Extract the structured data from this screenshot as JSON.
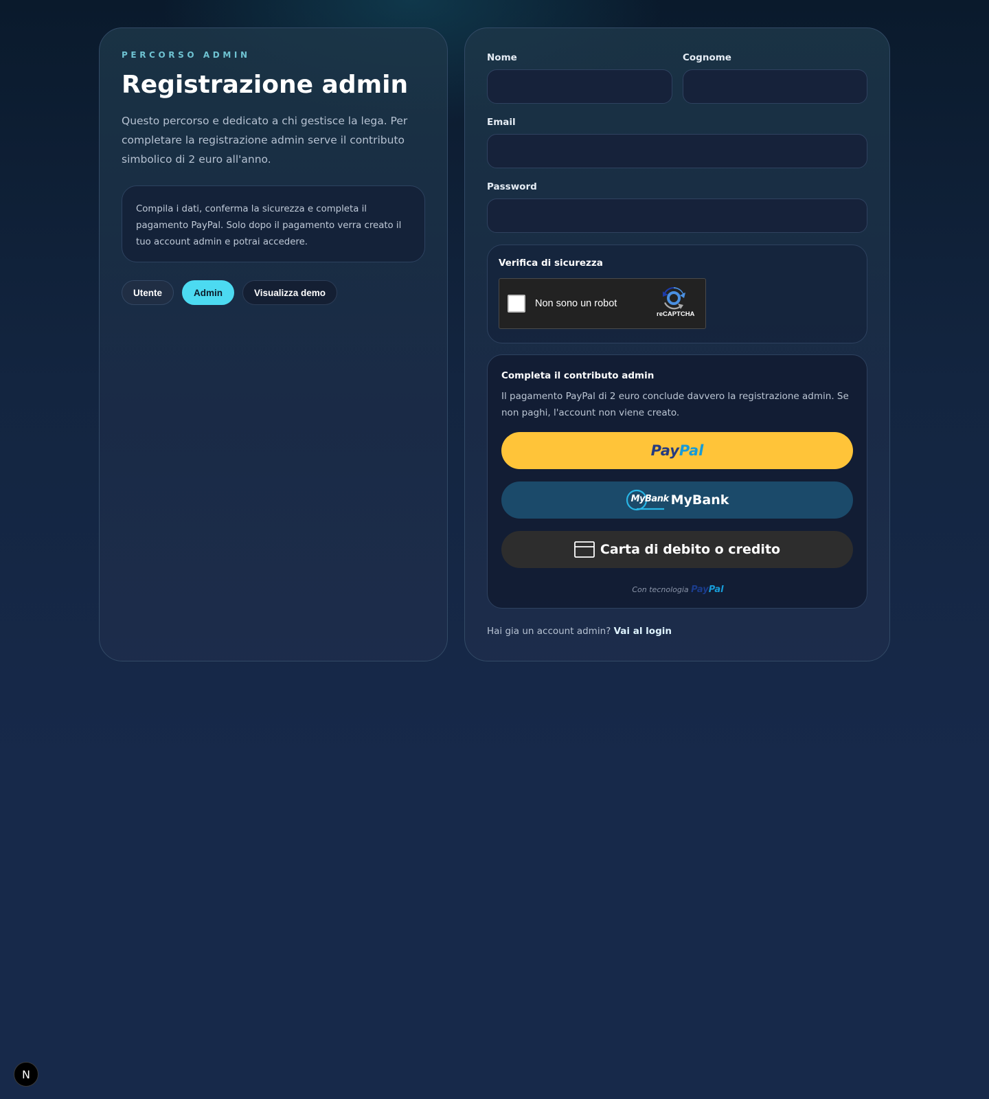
{
  "left": {
    "eyebrow": "PERCORSO ADMIN",
    "title": "Registrazione admin",
    "description": "Questo percorso e dedicato a chi gestisce la lega. Per completare la registrazione admin serve il contributo simbolico di 2 euro all'anno.",
    "info": "Compila i dati, conferma la sicurezza e completa il pagamento PayPal. Solo dopo il pagamento verra creato il tuo account admin e potrai accedere.",
    "chips": [
      {
        "label": "Utente"
      },
      {
        "label": "Admin"
      },
      {
        "label": "Visualizza demo"
      }
    ]
  },
  "form": {
    "first_name_label": "Nome",
    "last_name_label": "Cognome",
    "email_label": "Email",
    "password_label": "Password",
    "first_name_value": "",
    "last_name_value": "",
    "email_value": "",
    "password_value": ""
  },
  "security": {
    "title": "Verifica di sicurezza",
    "captcha_text": "Non sono un robot",
    "captcha_brand": "reCAPTCHA"
  },
  "payment": {
    "title": "Completa il contributo admin",
    "description": "Il pagamento PayPal di 2 euro conclude davvero la registrazione admin. Se non paghi, l'account non viene creato.",
    "paypal_a": "Pay",
    "paypal_b": "Pal",
    "mybank_logo_text": "MyBank",
    "mybank_label": "MyBank",
    "card_label": "Carta di debito o credito",
    "powered_prefix": "Con tecnologia"
  },
  "footer": {
    "question": "Hai gia un account admin?",
    "login_link": "Vai al login"
  },
  "badge": {
    "letter": "N"
  },
  "colors": {
    "accent": "#4cdaf1",
    "paypal_yellow": "#ffc439",
    "mybank_blue": "#1b4a6a",
    "card_dark": "#2d2d2d"
  }
}
